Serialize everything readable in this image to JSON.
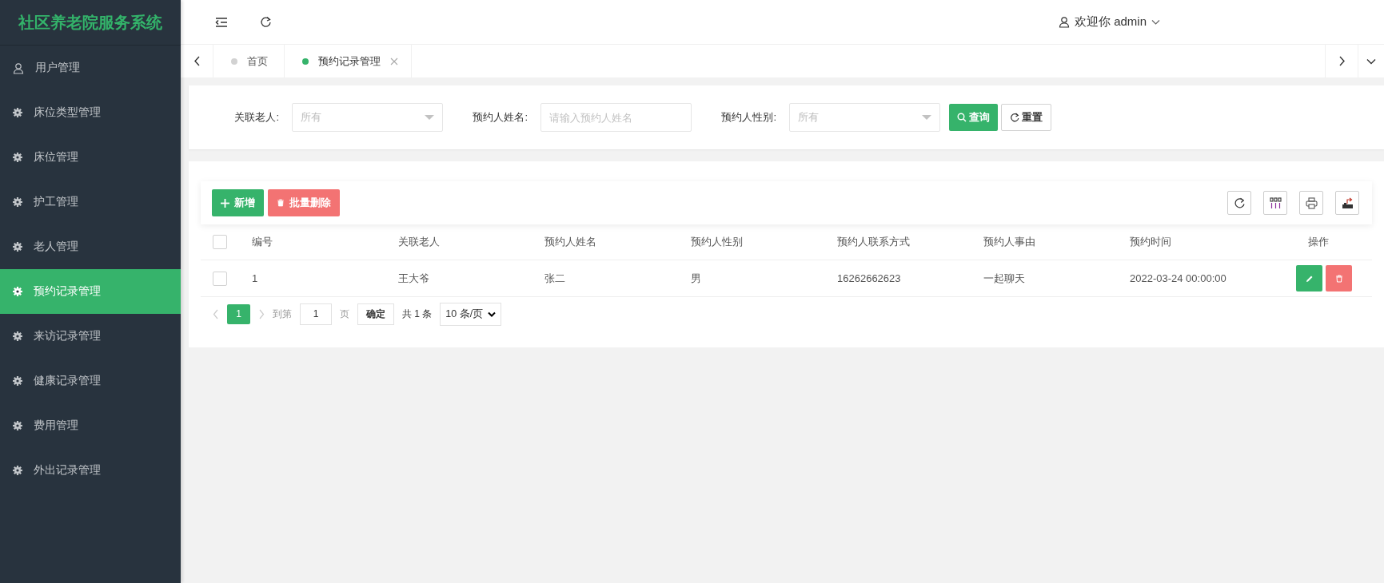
{
  "sidebar": {
    "title": "社区养老院服务系统",
    "items": [
      {
        "label": "用户管理",
        "kind": "user",
        "selected": false
      },
      {
        "label": "床位类型管理",
        "kind": "gear",
        "selected": false
      },
      {
        "label": "床位管理",
        "kind": "gear",
        "selected": false
      },
      {
        "label": "护工管理",
        "kind": "gear",
        "selected": false
      },
      {
        "label": "老人管理",
        "kind": "gear",
        "selected": false
      },
      {
        "label": "预约记录管理",
        "kind": "gear",
        "selected": true
      },
      {
        "label": "来访记录管理",
        "kind": "gear",
        "selected": false
      },
      {
        "label": "健康记录管理",
        "kind": "gear",
        "selected": false
      },
      {
        "label": "费用管理",
        "kind": "gear",
        "selected": false
      },
      {
        "label": "外出记录管理",
        "kind": "gear",
        "selected": false
      }
    ]
  },
  "header": {
    "user": "欢迎你 admin"
  },
  "tabs": [
    {
      "label": "首页",
      "selected": false,
      "closable": false
    },
    {
      "label": "预约记录管理",
      "selected": true,
      "closable": true
    }
  ],
  "filters": [
    {
      "label": "关联老人:",
      "kind": "select",
      "placeholder": "所有"
    },
    {
      "label": "预约人姓名:",
      "kind": "input",
      "placeholder": "请输入预约人姓名"
    },
    {
      "label": "预约人性别:",
      "kind": "select",
      "placeholder": "所有"
    }
  ],
  "filter_buttons": [
    {
      "label": "查询",
      "kind": "search"
    },
    {
      "label": "重置",
      "kind": "reset"
    }
  ],
  "toolbar": {
    "buttons": [
      {
        "label": "新增",
        "kind": "add"
      },
      {
        "label": "批量删除",
        "kind": "delete"
      }
    ]
  },
  "table": {
    "all_checked": false,
    "columns": [
      "编号",
      "关联老人",
      "预约人姓名",
      "预约人性别",
      "预约人联系方式",
      "预约人事由",
      "预约时间",
      "操作"
    ],
    "rows": [
      {
        "checked": false,
        "cells": [
          "1",
          "王大爷",
          "张二",
          "男",
          "16262662623",
          "一起聊天",
          "2022-03-24 00:00:00"
        ]
      }
    ]
  },
  "pagination": {
    "current": "1",
    "goto_label": "到第",
    "goto_value": "1",
    "page_unit": "页",
    "confirm": "确定",
    "total": "共 1 条",
    "page_size": "10 条/页"
  }
}
